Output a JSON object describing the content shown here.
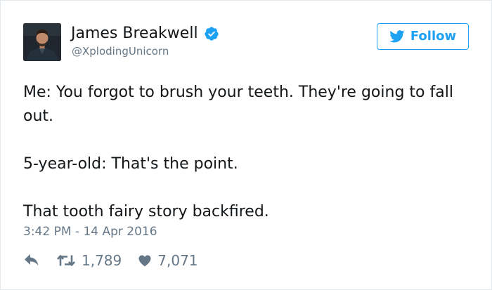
{
  "user": {
    "display_name": "James Breakwell",
    "handle": "@XplodingUnicorn",
    "verified": true,
    "avatar_icon": "profile-photo"
  },
  "follow_button": {
    "label": "Follow",
    "icon": "twitter-bird-icon"
  },
  "tweet": {
    "paragraphs": [
      "Me: You forgot to brush your teeth. They're going to fall out.",
      "5-year-old: That's the point.",
      "That tooth fairy story backfired."
    ],
    "timestamp": "3:42 PM - 14 Apr 2016"
  },
  "actions": {
    "reply_icon": "reply-icon",
    "retweet_icon": "retweet-icon",
    "retweet_count": "1,789",
    "like_icon": "heart-icon",
    "like_count": "7,071"
  },
  "colors": {
    "accent": "#1da1f2",
    "text": "#14171a",
    "muted": "#657786",
    "border": "#e1e8ed"
  }
}
